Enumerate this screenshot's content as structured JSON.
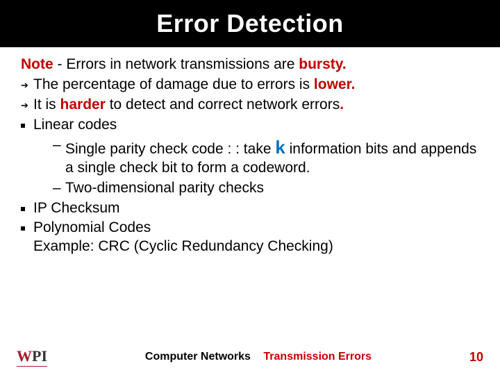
{
  "title": "Error Detection",
  "note": {
    "label": "Note",
    "dash": " - ",
    "line1_a": "Errors in network transmissions are ",
    "line1_b": "bursty",
    "line1_c": "."
  },
  "pts": {
    "p1_a": "The percentage of damage due to errors is ",
    "p1_b": "lower",
    "p1_c": ".",
    "p2_a": " It is ",
    "p2_b": "harder",
    "p2_c": " to detect and correct network errors",
    "p2_d": ".",
    "p3": " Linear codes",
    "p4": " IP Checksum",
    "p5_a": " Polynomial Codes",
    "p5_b": "Example: CRC (Cyclic Redundancy Checking)"
  },
  "sub": {
    "s1_a": "Single parity check code : : take ",
    "s1_k": "k",
    "s1_b": " information bits and appends a single check bit to form a codeword.",
    "s2": "Two-dimensional parity checks"
  },
  "footer": {
    "left1": "Computer Networks",
    "left2": "Transmission Errors",
    "page": "10"
  },
  "logo": {
    "w": "W",
    "pi": "PI"
  }
}
